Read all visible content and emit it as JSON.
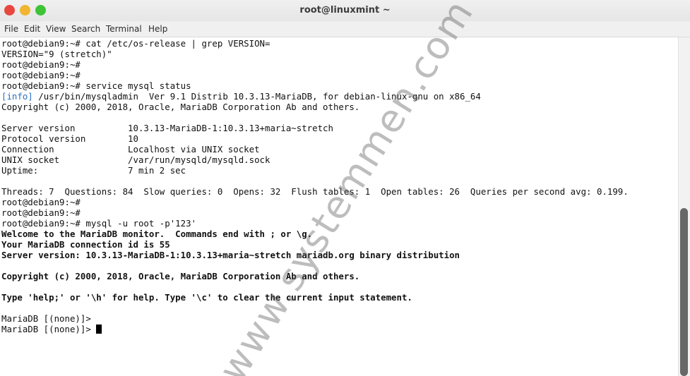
{
  "window": {
    "title": "root@linuxmint ~"
  },
  "menu": [
    "File",
    "Edit",
    "View",
    "Search",
    "Terminal",
    "Help"
  ],
  "terminal": {
    "lines": [
      "root@debian9:~# cat /etc/os-release | grep VERSION=",
      "VERSION=\"9 (stretch)\"",
      "root@debian9:~#",
      "root@debian9:~#",
      "root@debian9:~# service mysql status",
      "/usr/bin/mysqladmin  Ver 9.1 Distrib 10.3.13-MariaDB, for debian-linux-gnu on x86_64",
      "Copyright (c) 2000, 2018, Oracle, MariaDB Corporation Ab and others.",
      "",
      "Server version          10.3.13-MariaDB-1:10.3.13+maria~stretch",
      "Protocol version        10",
      "Connection              Localhost via UNIX socket",
      "UNIX socket             /var/run/mysqld/mysqld.sock",
      "Uptime:                 7 min 2 sec",
      "",
      "Threads: 7  Questions: 84  Slow queries: 0  Opens: 32  Flush tables: 1  Open tables: 26  Queries per second avg: 0.199.",
      "root@debian9:~#",
      "root@debian9:~#",
      "root@debian9:~# mysql -u root -p'123'",
      "Welcome to the MariaDB monitor.  Commands end with ; or \\g.",
      "Your MariaDB connection id is 55",
      "Server version: 10.3.13-MariaDB-1:10.3.13+maria~stretch mariadb.org binary distribution",
      "",
      "Copyright (c) 2000, 2018, Oracle, MariaDB Corporation Ab and others.",
      "",
      "Type 'help;' or '\\h' for help. Type '\\c' to clear the current input statement.",
      "",
      "MariaDB [(none)]>",
      "MariaDB [(none)]> "
    ],
    "info_tag": "[info]"
  },
  "watermark": "www.systemmen.com"
}
